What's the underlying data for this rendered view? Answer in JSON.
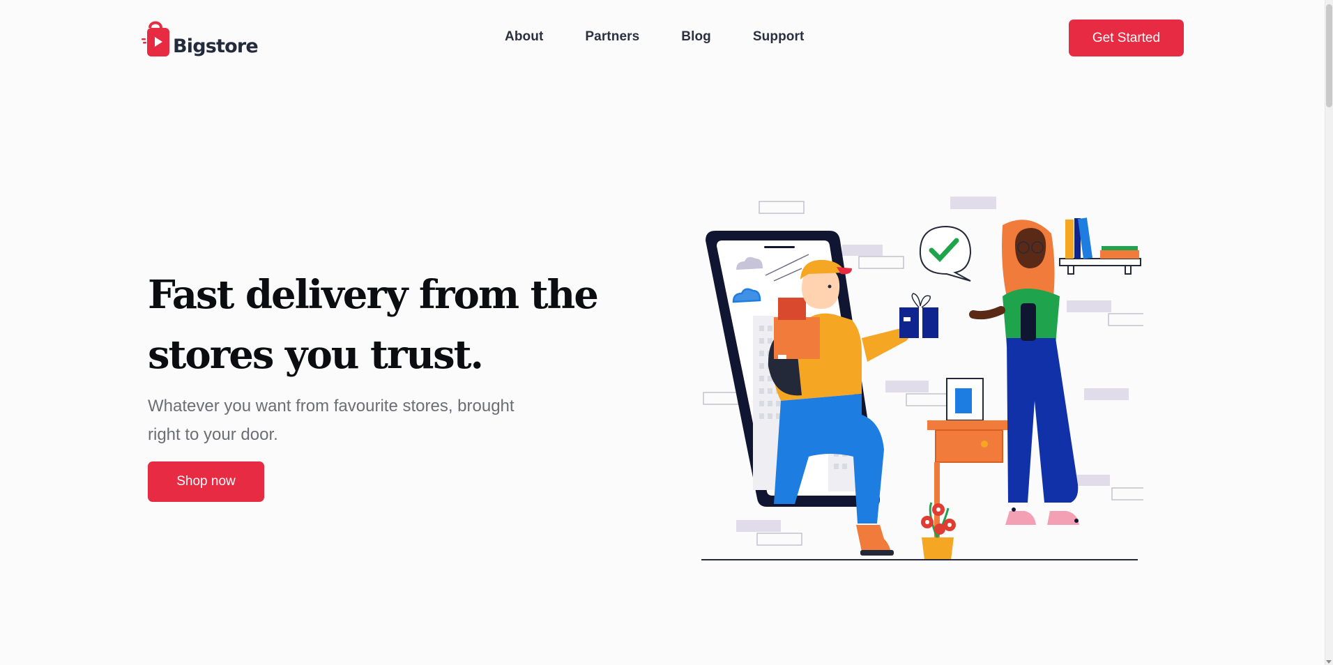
{
  "brand": {
    "name": "Bigstore",
    "icon": "shopping-bag-icon",
    "color": "#e72b43"
  },
  "nav": {
    "items": [
      {
        "label": "About"
      },
      {
        "label": "Partners"
      },
      {
        "label": "Blog"
      },
      {
        "label": "Support"
      }
    ]
  },
  "header": {
    "cta_label": "Get Started"
  },
  "hero": {
    "title_line1": "Fast delivery from the",
    "title_line2": "stores you trust.",
    "subtitle_line1": "Whatever you want from favourite stores, brought",
    "subtitle_line2": "right to your door.",
    "button_label": "Shop now"
  },
  "illustration": {
    "subject": "delivery-illustration"
  },
  "colors": {
    "accent": "#e72b43",
    "text": "#0c0d10",
    "muted": "#6d6e74",
    "background": "#fbfbfc"
  }
}
